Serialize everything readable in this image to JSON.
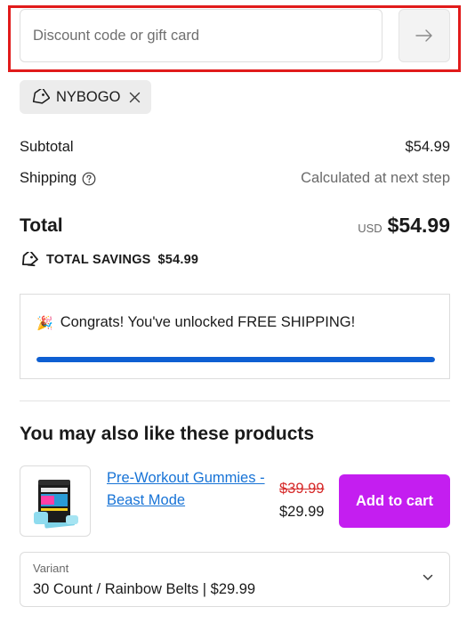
{
  "discount": {
    "placeholder": "Discount code or gift card",
    "value": ""
  },
  "applied_code": {
    "code": "NYBOGO"
  },
  "summary": {
    "subtotal_label": "Subtotal",
    "subtotal_value": "$54.99",
    "shipping_label": "Shipping",
    "shipping_value": "Calculated at next step",
    "total_label": "Total",
    "total_currency": "USD",
    "total_value": "$54.99",
    "savings_label": "TOTAL SAVINGS",
    "savings_value": "$54.99"
  },
  "promo": {
    "emoji": "🎉",
    "message": "Congrats! You've unlocked FREE SHIPPING!",
    "progress_percent": 100
  },
  "upsell": {
    "heading": "You may also like these products",
    "product": {
      "name": "Pre-Workout Gummies - Beast Mode",
      "compare_price": "$39.99",
      "price": "$29.99",
      "add_button_label": "Add to cart"
    },
    "variant": {
      "label": "Variant",
      "value": "30 Count / Rainbow Belts | $29.99"
    }
  },
  "icons": {
    "apply": "arrow-right-icon",
    "tag": "tag-icon",
    "remove": "close-icon",
    "help": "question-circle-icon",
    "savings": "tags-icon",
    "variant": "chevron-down-icon"
  },
  "colors": {
    "highlight": "#e11b1b",
    "link": "#1773d6",
    "compare_price": "#d62a2a",
    "add_button": "#c41ef0",
    "progress": "#0e5fd2"
  }
}
